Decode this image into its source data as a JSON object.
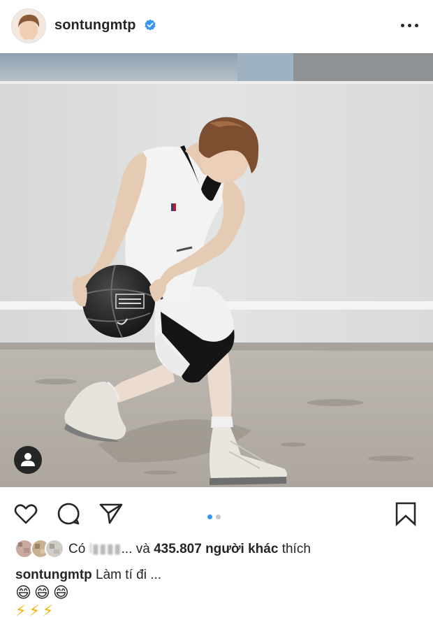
{
  "header": {
    "username": "sontungmtp",
    "more_label": "•••"
  },
  "post": {
    "carousel_count": 2,
    "carousel_index": 1
  },
  "likes": {
    "prefix": "Có",
    "blurred_name": "l▮▮▮▮",
    "ellipsis": "...",
    "and": "và",
    "count_text": "435.807 người khác",
    "suffix": "thích"
  },
  "caption": {
    "username": "sontungmtp",
    "text": "Làm tí đi ...",
    "emoji_line_1": "😄😄😄",
    "emoji_line_2": "⚡⚡⚡"
  },
  "colors": {
    "verified_blue": "#3897f0",
    "text": "#262626",
    "dot_active": "#3897f0",
    "dot_inactive": "#c7c7c7"
  }
}
